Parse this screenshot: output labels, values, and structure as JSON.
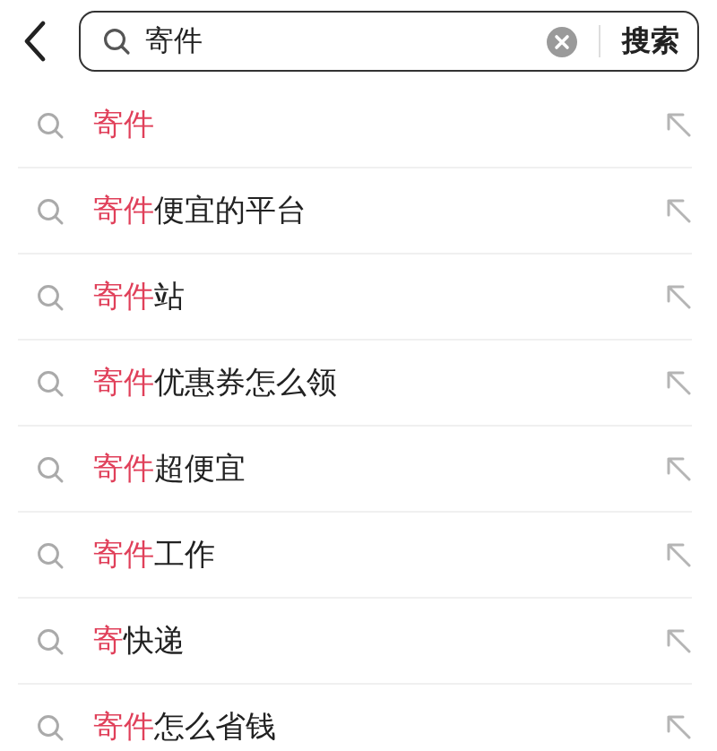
{
  "search": {
    "value": "寄件",
    "button": "搜索"
  },
  "suggestions": [
    {
      "highlight": "寄件"
    },
    {
      "highlight": "寄件",
      "rest": "便宜的平台"
    },
    {
      "highlight": "寄件",
      "rest": "站"
    },
    {
      "highlight": "寄件",
      "rest": "优惠券怎么领"
    },
    {
      "highlight": "寄件",
      "rest": "超便宜"
    },
    {
      "highlight": "寄件",
      "rest": "工作"
    },
    {
      "highlight": "寄",
      "rest": "快递"
    },
    {
      "highlight": "寄件",
      "rest": "怎么省钱"
    }
  ]
}
